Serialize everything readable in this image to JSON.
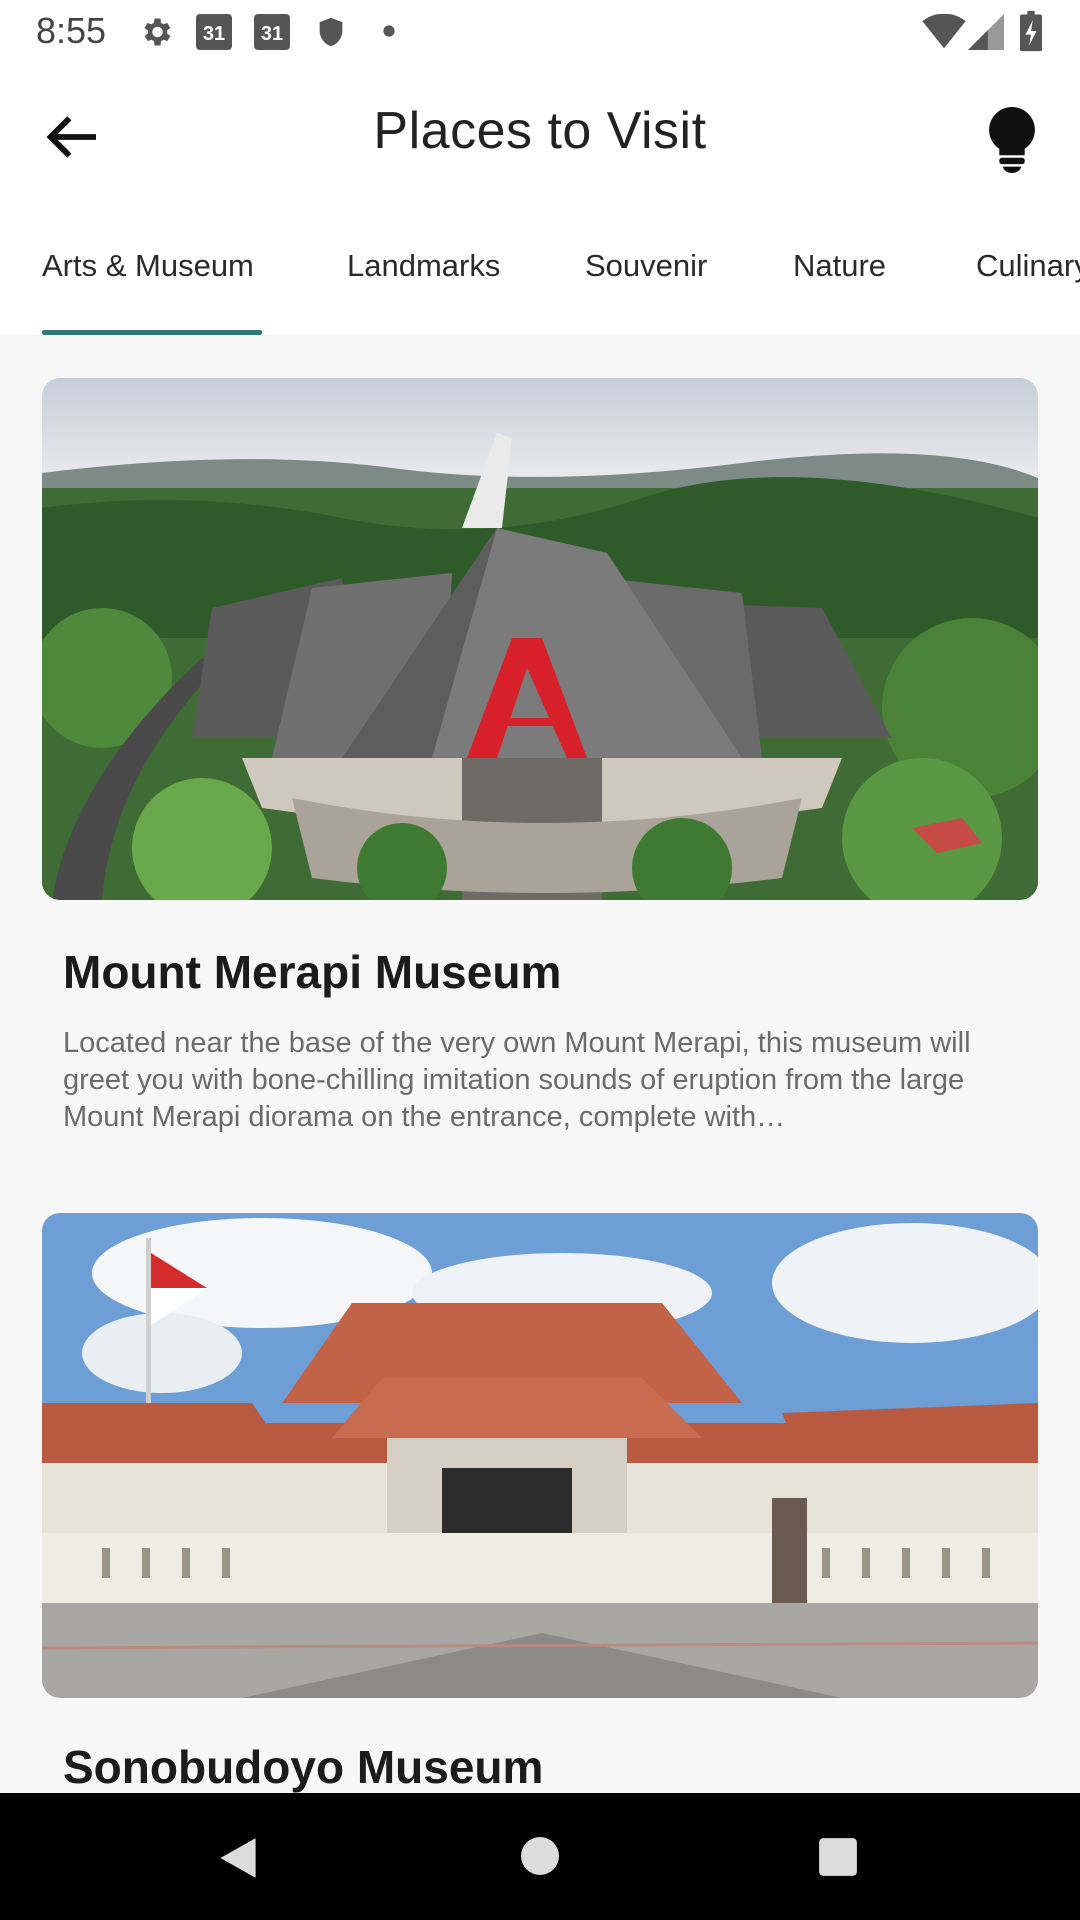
{
  "status_bar": {
    "time": "8:55",
    "icons": [
      "gear-icon",
      "calendar-icon",
      "calendar-icon",
      "shield-icon",
      "dot-icon",
      "wifi-icon",
      "signal-icon",
      "battery-icon"
    ],
    "calendar_day": "31"
  },
  "app_bar": {
    "title": "Places to Visit",
    "back_icon": "arrow-left-icon",
    "tip_icon": "lightbulb-icon"
  },
  "tabs": [
    {
      "label": "Arts & Museum",
      "selected": true
    },
    {
      "label": "Landmarks",
      "selected": false
    },
    {
      "label": "Souvenir",
      "selected": false
    },
    {
      "label": "Nature",
      "selected": false
    },
    {
      "label": "Culinary",
      "selected": false
    }
  ],
  "colors": {
    "accent": "#2e7b7a",
    "background": "#f7f7f7",
    "surface": "#ffffff",
    "nav_bar": "#000000"
  },
  "places": [
    {
      "name": "Mount Merapi Museum",
      "description": "Located near the base of the very own Mount Merapi, this museum will greet you with bone-chilling imitation sounds of eruption from the large Mount Merapi diorama on the entrance, complete with…"
    },
    {
      "name": "Sonobudoyo Museum"
    }
  ],
  "nav_bar": {
    "icons": [
      "back-triangle-icon",
      "home-circle-icon",
      "recents-square-icon"
    ]
  }
}
